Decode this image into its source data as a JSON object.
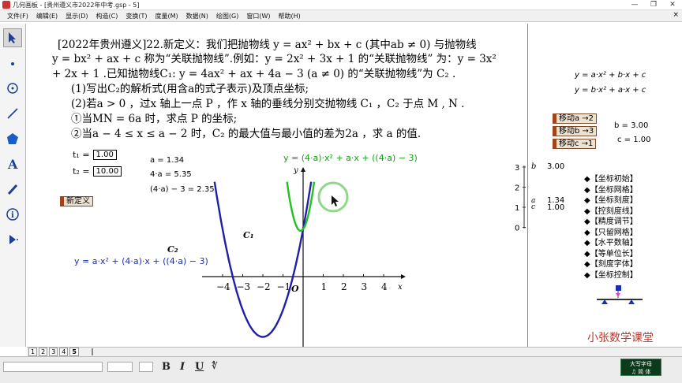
{
  "window": {
    "title": "几何画板 - [贵州遵义市2022年中考.gsp - 5]",
    "minimize": "—",
    "maximize": "❐",
    "close": "✕"
  },
  "menu": [
    "文件(F)",
    "编辑(E)",
    "显示(D)",
    "构造(C)",
    "变换(T)",
    "度量(M)",
    "数据(N)",
    "绘图(G)",
    "窗口(W)",
    "帮助(H)"
  ],
  "menu_close": "×",
  "tools": [
    {
      "name": "arrow-tool-icon",
      "glyph": "↖"
    },
    {
      "name": "point-tool-icon",
      "glyph": "•"
    },
    {
      "name": "compass-tool-icon",
      "glyph": "⊙"
    },
    {
      "name": "straightedge-tool-icon",
      "glyph": "/"
    },
    {
      "name": "polygon-tool-icon",
      "glyph": "⬟"
    },
    {
      "name": "text-tool-icon",
      "glyph": "A"
    },
    {
      "name": "marker-tool-icon",
      "glyph": "✎"
    },
    {
      "name": "info-tool-icon",
      "glyph": "ⓘ"
    },
    {
      "name": "custom-tool-icon",
      "glyph": "▶"
    }
  ],
  "problem": {
    "line1": "[2022年贵州遵义]22.新定义：我们把抛物线 y = ax² + bx + c (其中ab ≠ 0) 与抛物线",
    "line2": "y = bx² + ax + c 称为“关联抛物线”.例如：y = 2x² + 3x + 1 的“关联抛物线” 为：y = 3x²",
    "line3": "+ 2x + 1 .已知抛物线C₁: y = 4ax² + ax + 4a − 3 (a ≠ 0) 的“关联抛物线”为 C₂ .",
    "line4": "(1)写出C₂的解析式(用含a的式子表示)及顶点坐标;",
    "line5": "(2)若a > 0 ，过x 轴上一点 P ，作 x 轴的垂线分别交抛物线 C₁ ，C₂ 于点 M , N .",
    "line6": "①当MN = 6a 时，求点 P 的坐标;",
    "line7": "②当a − 4 ≤ x ≤ a − 2 时，C₂ 的最大值与最小值的差为2a ，求 a 的值."
  },
  "params": {
    "t1_label": "t₁ =",
    "t1_value": "1.00",
    "t2_label": "t₂ =",
    "t2_value": "10.00"
  },
  "new_def_button": "新定义",
  "calcs": {
    "a": "a = 1.34",
    "four_a": "4·a = 5.35",
    "four_a_minus_3": "(4·a) − 3 = 2.35"
  },
  "curve_labels": {
    "c1_eq": "y = (4·a)·x² + a·x + ((4·a) − 3)",
    "c2_eq": "y = a·x² + (4·a)·x + ((4·a) − 3)",
    "c1": "C₁",
    "c2": "C₂",
    "y_axis": "y",
    "x_axis": "x",
    "origin": "O"
  },
  "right_panel": {
    "eq1": "y = a·x² + b·x + c",
    "eq2": "y = b·x² + a·x + c",
    "move_a": "移动a →2",
    "move_b": "移动b →3",
    "move_c": "移动c →1",
    "b_val": "b = 3.00",
    "c_val": "c = 1.00",
    "slider_b_value": "3.00",
    "slider_a_value": "1.34",
    "slider_c_value": "1.00",
    "slider_ticks": [
      "3",
      "2",
      "1",
      "0"
    ],
    "slider_letters": {
      "b": "b",
      "a": "a",
      "c": "c"
    }
  },
  "controls": [
    "◆【坐标初始】",
    "◆【坐标网格】",
    "◆【坐标刻度】",
    "◆【控刻度线】",
    "◆【精度调节】",
    "◆【只留网格】",
    "◆【水平数轴】",
    "◆【等单位长】",
    "◆【刻度字体】",
    "◆【坐标控制】"
  ],
  "brand": "小张数学课堂",
  "page_tabs": [
    "1",
    "2",
    "3",
    "4",
    "5"
  ],
  "format_buttons": {
    "bold": "B",
    "italic": "I",
    "underline": "U",
    "symbol": "∜"
  },
  "ime": {
    "line1": "大写字母",
    "line2": "♫ 简 体"
  },
  "colors": {
    "c1": "#22c023",
    "c2": "#1f1fa8",
    "c1_label": "#12a012",
    "c2_label": "#1a2fb5",
    "button_accent": "#a0451a",
    "brand": "#c0362c",
    "highlight_circle": "#8fd88a"
  },
  "chart_data": {
    "type": "line",
    "series": [
      {
        "name": "C₁",
        "equation": "y = 5.35x² + 1.34x + 2.35"
      },
      {
        "name": "C₂",
        "equation": "y = 1.34x² + 5.35x + 2.35"
      }
    ],
    "x_ticks": [
      "−4",
      "−3",
      "−2",
      "−1",
      "1",
      "2",
      "3",
      "4"
    ],
    "xlim": [
      -4.5,
      4.5
    ]
  }
}
